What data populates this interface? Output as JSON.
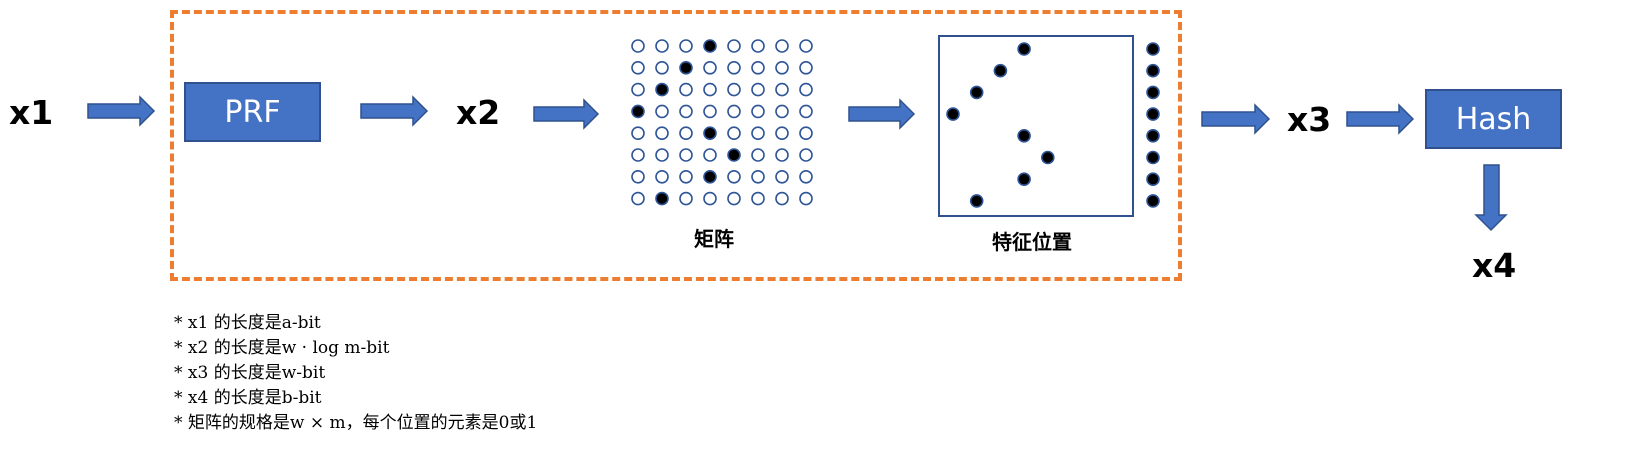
{
  "labels": {
    "x1": "x1",
    "x2": "x2",
    "x3": "x3",
    "x4": "x4"
  },
  "boxes": {
    "prf": "PRF",
    "hash": "Hash"
  },
  "captions": {
    "matrix": "矩阵",
    "features": "特征位置"
  },
  "matrix": {
    "rows": 8,
    "cols": 8,
    "filled_col_per_row": [
      3,
      2,
      1,
      0,
      3,
      4,
      3,
      1
    ]
  },
  "feature_points": [
    {
      "x": 3,
      "y": 0
    },
    {
      "x": 2,
      "y": 1
    },
    {
      "x": 1,
      "y": 2
    },
    {
      "x": 0,
      "y": 3
    },
    {
      "x": 3,
      "y": 4
    },
    {
      "x": 4,
      "y": 5
    },
    {
      "x": 3,
      "y": 6
    },
    {
      "x": 1,
      "y": 7
    }
  ],
  "column_dots": 8,
  "notes": [
    "* x1 的长度是a-bit",
    "* x2 的长度是w · log m-bit",
    "* x3 的长度是w-bit",
    "* x4 的长度是b-bit",
    "* 矩阵的规格是w × m，每个位置的元素是0或1"
  ],
  "colors": {
    "box_fill": "#4472C4",
    "box_border": "#2F528F",
    "arrow": "#4472C4",
    "dashed_border": "#ED7D31",
    "dot_outline": "#2E5597",
    "dot_fill": "#000000"
  }
}
